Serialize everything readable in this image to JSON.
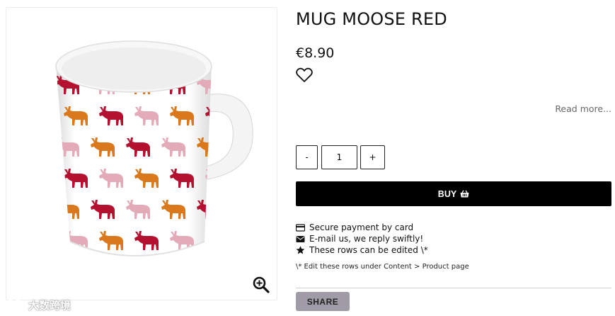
{
  "product": {
    "title": "MUG MOOSE RED",
    "price": "€8.90",
    "image_alt": "Mug with red, orange and pink moose pattern"
  },
  "actions": {
    "read_more": "Read more...",
    "quantity_minus": "-",
    "quantity_value": "1",
    "quantity_plus": "+",
    "buy_label": "BUY",
    "share_label": "SHARE"
  },
  "features": [
    {
      "icon": "credit-card-icon",
      "text": "Secure payment by card"
    },
    {
      "icon": "envelope-icon",
      "text": "E-mail us, we reply swiftly!"
    },
    {
      "icon": "star-icon",
      "text": "These rows can be edited \\*"
    }
  ],
  "note": "\\* Edit these rows under Content > Product page",
  "watermark": {
    "text": "大数跨境"
  },
  "icons": {
    "wishlist": "heart-outline-icon",
    "zoom": "zoom-in-icon",
    "buy": "basket-icon"
  },
  "colors": {
    "buy_button": "#000000",
    "share_button": "#a09ba6",
    "moose_red": "#b3112f",
    "moose_orange": "#d9781c",
    "moose_pink": "#e3aab8"
  }
}
